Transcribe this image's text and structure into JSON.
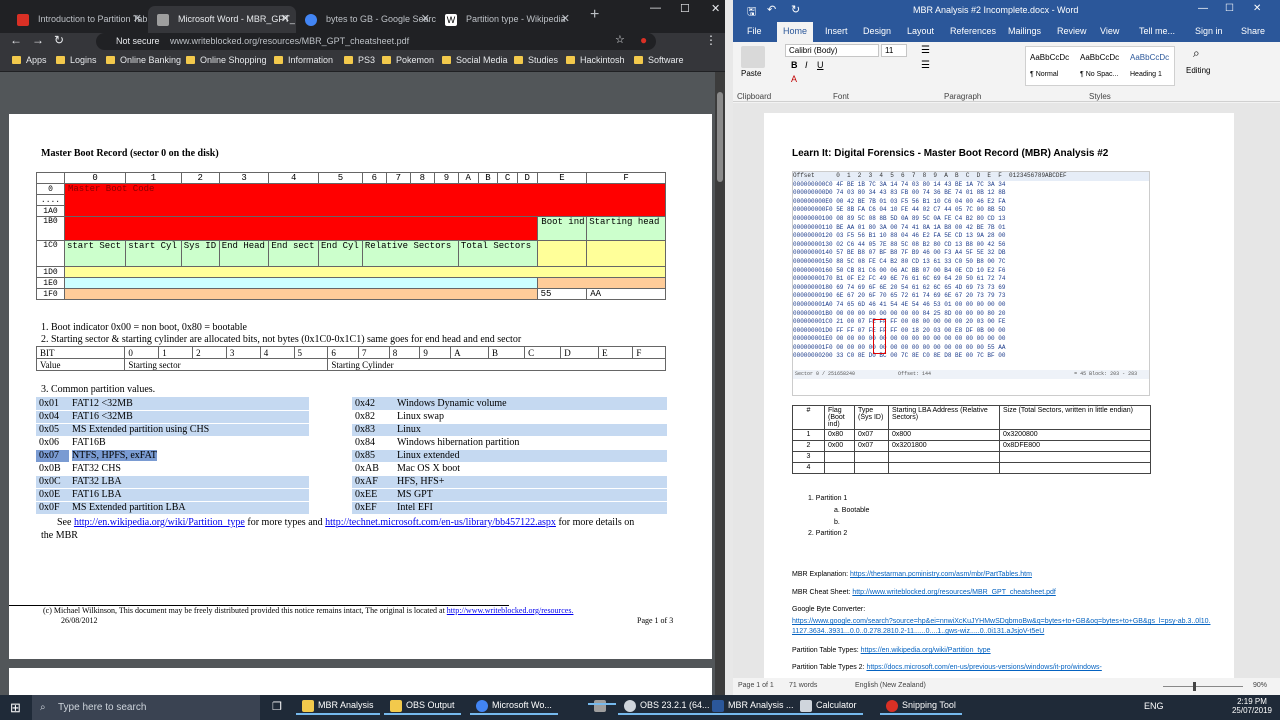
{
  "chrome": {
    "tabs": [
      {
        "label": "Introduction to Partition Tabl",
        "color": "#d93025"
      },
      {
        "label": "Microsoft Word - MBR_GPT_",
        "color": "#9e9e9e",
        "active": true
      },
      {
        "label": "bytes to GB - Google Search",
        "color": "#4285f4"
      },
      {
        "label": "Partition type - Wikipedia",
        "color": "#ffffff"
      }
    ],
    "address": {
      "security": "Not secure",
      "url": "www.writeblocked.org/resources/MBR_GPT_cheatsheet.pdf"
    },
    "bookmarks": [
      "Apps",
      "Logins",
      "Online Banking",
      "Online Shopping",
      "Information",
      "PS3",
      "Pokemon",
      "Social Media",
      "Studies",
      "Hackintosh",
      "Software"
    ]
  },
  "pdf": {
    "title": "Master Boot Record (sector 0 on the disk)",
    "mbr_header": [
      "0",
      "1",
      "2",
      "3",
      "4",
      "5",
      "6",
      "7",
      "8",
      "9",
      "A",
      "B",
      "C",
      "D",
      "E",
      "F"
    ],
    "row_labels": [
      "0",
      "....",
      "1A0",
      "1B0",
      "1C0",
      "1D0",
      "1E0",
      "1F0"
    ],
    "master_boot_code": "Master Boot Code",
    "boot_ind": "Boot ind",
    "starting_head": "Starting head",
    "fields_1c0": [
      "start Sect",
      "start Cyl",
      "Sys ID",
      "End Head",
      "End sect",
      "End Cyl",
      "Relative Sectors",
      "Total Sectors"
    ],
    "sig": [
      "55",
      "AA"
    ],
    "note1": "1. Boot indicator 0x00 = non boot, 0x80 = bootable",
    "note2": "2.  Starting sector & starting cylinder are allocated bits, not bytes  (0x1C0-0x1C1)  same goes for end head and end sector",
    "bit_header": [
      "BIT",
      "0",
      "1",
      "2",
      "3",
      "4",
      "5",
      "6",
      "7",
      "8",
      "9",
      "A",
      "B",
      "C",
      "D",
      "E",
      "F"
    ],
    "value_row": [
      "Value",
      "Starting sector",
      "Starting Cylinder"
    ],
    "note3": "3.  Common partition values.",
    "left_values": [
      [
        "0x01",
        "FAT12 <32MB"
      ],
      [
        "0x04",
        "FAT16 <32MB"
      ],
      [
        "0x05",
        "MS Extended partition using CHS"
      ],
      [
        "0x06",
        "FAT16B"
      ],
      [
        "0x07",
        "NTFS, HPFS, exFAT"
      ],
      [
        "0x0B",
        "FAT32 CHS"
      ],
      [
        "0x0C",
        "FAT32 LBA"
      ],
      [
        "0x0E",
        "FAT16 LBA"
      ],
      [
        "0x0F",
        "MS Extended partition LBA"
      ]
    ],
    "right_values": [
      [
        "0x42",
        "Windows Dynamic volume"
      ],
      [
        "0x82",
        "Linux swap"
      ],
      [
        "0x83",
        "Linux"
      ],
      [
        "0x84",
        "Windows hibernation partition"
      ],
      [
        "0x85",
        "Linux extended"
      ],
      [
        "0xAB",
        "Mac OS X boot"
      ],
      [
        "0xAF",
        "HFS, HFS+"
      ],
      [
        "0xEE",
        "MS GPT"
      ],
      [
        "0xEF",
        "Intel EFI"
      ]
    ],
    "see_prefix": "See",
    "see_link1": "http://en.wikipedia.org/wiki/Partition_type",
    "see_mid": "for more types and",
    "see_link2": "http://technet.microsoft.com/en-us/library/bb457122.aspx",
    "see_suffix": "for more details on",
    "see_end": "the MBR",
    "footer": "(c) Michael Wilkinson, This document may be freely distributed provided this notice remains intact, The original is located at",
    "footer_link": "http://www.writeblocked.org/resources.",
    "footer_date": "26/08/2012",
    "footer_page": "Page 1 of 3"
  },
  "word": {
    "title": "MBR Analysis #2 Incomplete.docx - Word",
    "menu": [
      "File",
      "Home",
      "Insert",
      "Design",
      "Layout",
      "References",
      "Mailings",
      "Review",
      "View",
      "Tell me...",
      "Sign in",
      "Share"
    ],
    "font": "Calibri (Body)",
    "size": "11",
    "styles": [
      "¶ Normal",
      "¶ No Spac...",
      "Heading 1"
    ],
    "style_preview": "AaBbCcDc",
    "groups": [
      "Clipboard",
      "Font",
      "Paragraph",
      "Styles",
      "Editing"
    ],
    "paste": "Paste",
    "editing": "Editing",
    "doc_title": "Learn It: Digital Forensics - Master Boot Record (MBR) Analysis #2",
    "hex_header": "Offset      0  1  2  3  4  5  6  7  8  9  A  B  C  D  E  F  0123456789ABCDEF",
    "hex_lines": [
      "000000000C0 4F BE 1B 7C 3A 14 74 03 80 14 43 BE 1A 7C 3A 34",
      "000000000D0 74 03 80 34 43 83 FB 00 74 36 BE 74 01 8B 12 8B",
      "000000000E0 00 42 BE 7B 01 03 F5 56 B1 10 C6 04 00 46 E2 FA",
      "000000000F0 5E 8B FA C6 04 10 FE 44 02 C7 44 05 7C 00 8B 5D",
      "00000000100 08 89 5C 08 8B 5D 0A 89 5C 0A FE C4 B2 80 CD 13",
      "00000000110 BE AA 01 80 3A 00 74 41 8A 1A B8 00 42 BE 7B 01",
      "00000000120 03 F5 56 B1 10 88 04 46 E2 FA 5E CD 13 9A 28 00",
      "00000000130 02 C6 44 05 7E 88 5C 08 B2 80 CD 13 B8 00 42 56",
      "00000000140 57 BE B8 07 BF B8 7F B9 46 00 F3 A4 5F 5E 32 DB",
      "00000000150 88 5C 08 FE C4 B2 80 CD 13 61 33 C0 50 B8 00 7C",
      "00000000160 50 CB 81 C6 00 06 AC BB 07 00 B4 0E CD 10 E2 F6",
      "00000000170 B1 0F E2 FC 49 6E 76 61 6C 69 64 20 50 61 72 74",
      "00000000180 69 74 69 6F 6E 20 54 61 62 6C 65 4D 69 73 73 69",
      "00000000190 6E 67 20 6F 70 65 72 61 74 69 6E 67 20 73 79 73",
      "000000001A0 74 65 6D 46 41 54 4E 54 46 53 01 00 00 00 00 00",
      "000000001B0 00 00 00 00 00 00 00 00 84 25 8D 00 00 00 80 20",
      "000000001C0 21 00 07 FE FF FF 00 08 00 00 00 00 20 03 00 FE",
      "000000001D0 FF FF 07 FE FF FF 00 18 20 03 00 E8 DF 0B 00 00",
      "000000001E0 00 00 00 00 00 00 00 00 00 00 00 00 00 00 00 00",
      "000000001F0 00 00 00 00 00 00 00 00 00 00 00 00 00 00 55 AA",
      "00000000200 33 C0 8E D0 BC 00 7C 8E C0 8E D8 BE 00 7C BF 00"
    ],
    "hex_status": [
      "Sector 0 / 251658240",
      "Offset: 144",
      "= 45  Block: 203 - 283"
    ],
    "table_head": [
      "#",
      "Flag (Boot ind)",
      "Type (Sys ID)",
      "Starting LBA Address (Relative Sectors)",
      "Size (Total Sectors, written in little endian)"
    ],
    "table_rows": [
      [
        "1",
        "0x80",
        "0x07",
        "0x800",
        "0x3200800"
      ],
      [
        "2",
        "0x00",
        "0x07",
        "0x3201800",
        "0x8DFE800"
      ],
      [
        "3",
        "",
        "",
        "",
        ""
      ],
      [
        "4",
        "",
        "",
        "",
        ""
      ]
    ],
    "list": [
      "Partition 1",
      "Bootable",
      "Partition 2"
    ],
    "list_markers": [
      "1.",
      "a.",
      "b.",
      "2."
    ],
    "refs": [
      {
        "label": "MBR Explanation:",
        "link": "https://thestarman.pcministry.com/asm/mbr/PartTables.htm"
      },
      {
        "label": "MBR Cheat Sheet:",
        "link": "http://www.writeblocked.org/resources/MBR_GPT_cheatsheet.pdf"
      },
      {
        "label": "Google Byte Converter:",
        "link": "https://www.google.com/search?source=hp&ei=nnwiXcKuJYHMwSDqbmoBw&q=bytes+to+GB&oq=bytes+to+GB&gs_l=psy-ab.3..0l10.1127.3634..3931...0.0..0.278.2810.2-11......0....1..gws-wiz.....0..0i131.aJsjoV-t5eU"
      },
      {
        "label": "Partition Table Types:",
        "link": "https://en.wikipedia.org/wiki/Partition_type"
      },
      {
        "label": "Partition Table Types 2:",
        "link": "https://docs.microsoft.com/en-us/previous-versions/windows/it-pro/windows-"
      }
    ],
    "status_page": "Page 1 of 1",
    "status_words": "71 words",
    "status_lang": "English (New Zealand)",
    "zoom": "90%"
  },
  "taskbar": {
    "search": "Type here to search",
    "items": [
      {
        "label": "MBR Analysis",
        "color": "#f2c94c"
      },
      {
        "label": "OBS Output",
        "color": "#f2c94c"
      },
      {
        "label": "Microsoft Wo...",
        "color": "#4285f4"
      },
      {
        "label": "",
        "color": "#9e9e9e"
      },
      {
        "label": "OBS 23.2.1 (64...",
        "color": "#cfd5dc"
      },
      {
        "label": "MBR Analysis ...",
        "color": "#2b579a"
      },
      {
        "label": "Calculator",
        "color": "#cfd5dc"
      },
      {
        "label": "Snipping Tool",
        "color": "#d93025"
      }
    ],
    "lang": "ENG",
    "time": "2:19 PM",
    "date": "25/07/2019"
  }
}
